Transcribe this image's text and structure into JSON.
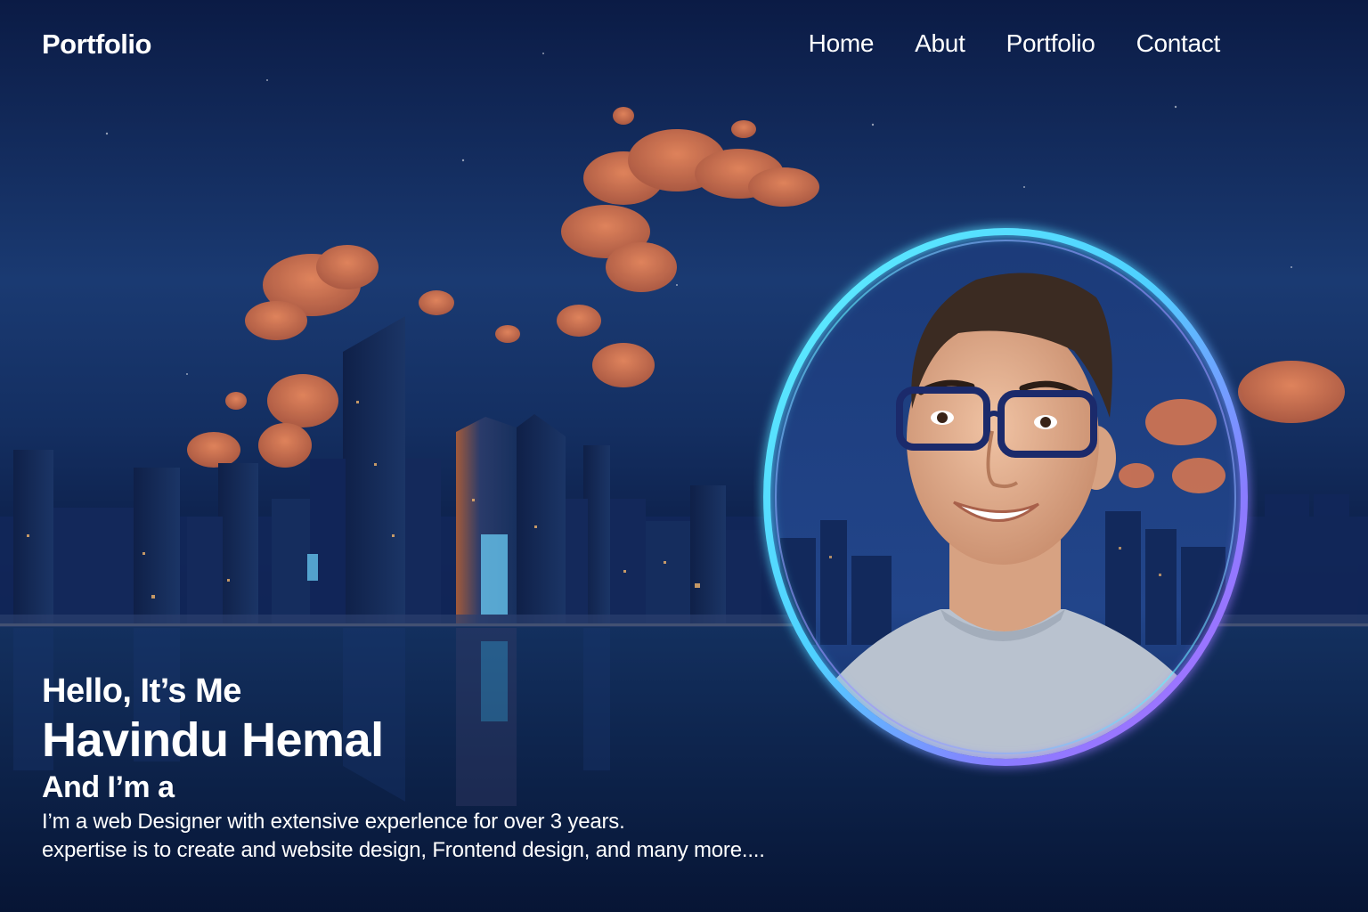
{
  "header": {
    "brand": "Portfolio",
    "nav": [
      {
        "label": "Home"
      },
      {
        "label": "Abut"
      },
      {
        "label": "Portfolio"
      },
      {
        "label": "Contact"
      }
    ]
  },
  "hero": {
    "greeting": "Hello, It’s Me",
    "name": "Havindu Hemal",
    "role": "And I’m a",
    "description_line1": "I’m a web Designer with extensive experlence for over 3 years.",
    "description_line2": "expertise is to create and website design, Frontend design, and many more...."
  },
  "colors": {
    "background": "#0d1f4a",
    "text": "#ffffff",
    "ring_cyan": "#5ff0ff",
    "ring_purple": "#b26bff",
    "cloud": "#e0794e"
  }
}
